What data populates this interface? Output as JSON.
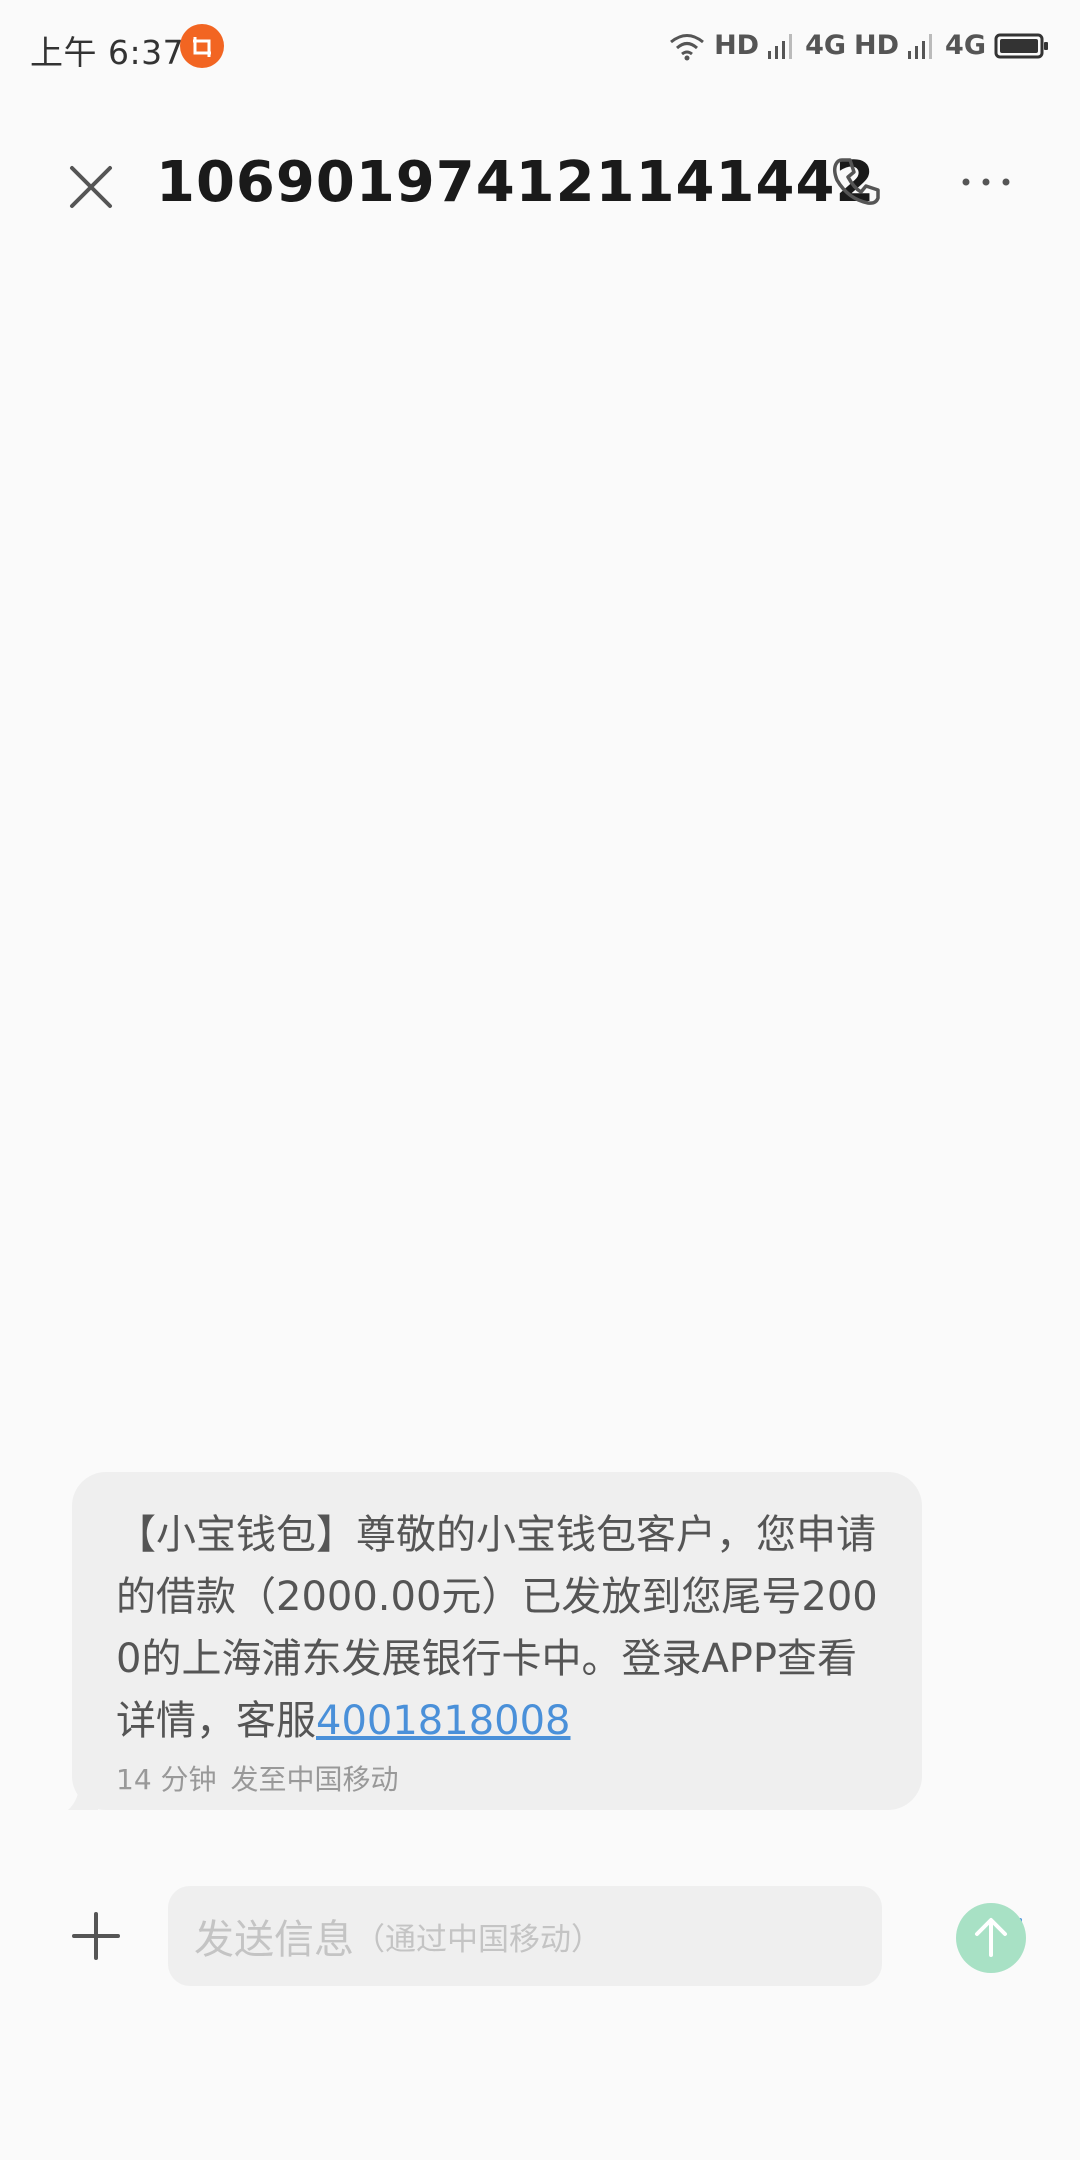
{
  "status_bar": {
    "time": "上午 6:37",
    "hd1": "HD",
    "net1": "4G",
    "hd2": "HD",
    "net2": "4G",
    "app_icon_color": "#f26522"
  },
  "header": {
    "title": "106901974121141442",
    "icons": [
      "close-icon",
      "phone-icon",
      "more-icon"
    ]
  },
  "message": {
    "text": "【小宝钱包】尊敬的小宝钱包客户，您申请的借款（2000.00元）已发放到您尾号2000的上海浦东发展银行卡中。登录APP查看详情，客服",
    "link": "4001818008",
    "time": "14 分钟",
    "carrier": "发至中国移动"
  },
  "compose": {
    "placeholder": "发送信息",
    "placeholder_sub": "（通过中国移动）",
    "sim_number": "1",
    "send_color": "#a8e1c5"
  }
}
